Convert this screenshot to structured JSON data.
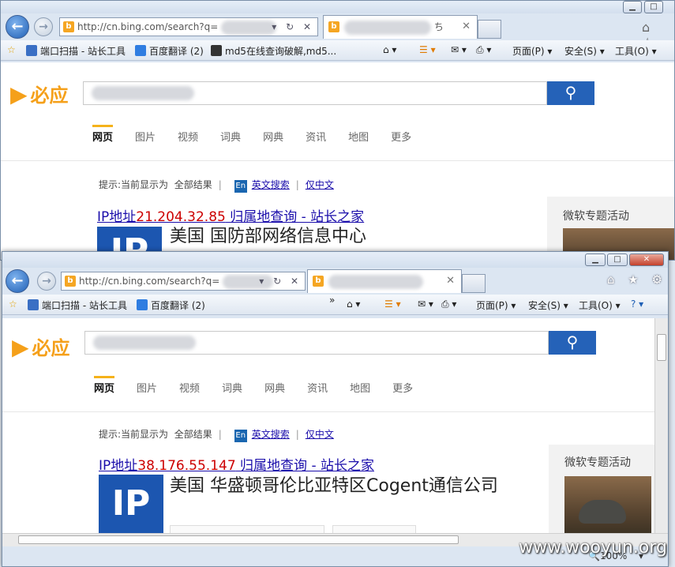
{
  "watermark": "www.wooyun.org",
  "common": {
    "back_glyph": "←",
    "fwd_glyph": "→",
    "url": "http://cn.bing.com/search?q=",
    "addr_controls": "▾ ↻ ✕",
    "tab_close": "✕",
    "logo_text": "必应",
    "logo_glyph": "▶",
    "search_icon": "⚲",
    "scopes": [
      "网页",
      "图片",
      "视频",
      "词典",
      "网典",
      "资讯",
      "地图",
      "更多"
    ],
    "hint_prefix": "提示:当前显示为",
    "hint_all": "全部结果",
    "hint_en_badge": "En",
    "hint_en_link": "英文搜索",
    "hint_cn_link": "仅中文",
    "side_title": "微软专题活动",
    "fav_star_glyph": "☆",
    "fav_items": [
      "端口扫描 - 站长工具",
      "百度翻译 (2)"
    ],
    "cmd_home": "⌂ ▾",
    "cmd_feed": "☰ ▾",
    "cmd_mail": "✉ ▾",
    "cmd_print": "⎙ ▾",
    "cmd_page": "页面(P) ▾",
    "cmd_safety": "安全(S) ▾",
    "cmd_tools": "工具(O) ▾",
    "cmd_help": "? ▾",
    "ip_badge": "IP",
    "caption_min": "▁",
    "caption_max": "□",
    "caption_close": "✕"
  },
  "window_back": {
    "extra_fav": "md5在线查询破解,md5...",
    "tab_label": "ち",
    "result_title_prefix": "IP地址",
    "result_ip": "21.204.32.85",
    "result_title_suffix": " 归属地查询 - 站长之家",
    "result_heading": "美国 国防部网络信息中心",
    "side_icons": "⌂ ☆"
  },
  "window_front": {
    "result_title_prefix": "IP地址",
    "result_ip": "38.176.55.147",
    "result_title_suffix": " 归属地查询 - 站长之家",
    "result_heading": "美国 华盛顿哥伦比亚特区Cogent通信公司",
    "toolbar_icons": "⌂ ★ ⚙",
    "chevron": "»",
    "zoom": "🔍100%",
    "zoom_caret": "▾"
  }
}
